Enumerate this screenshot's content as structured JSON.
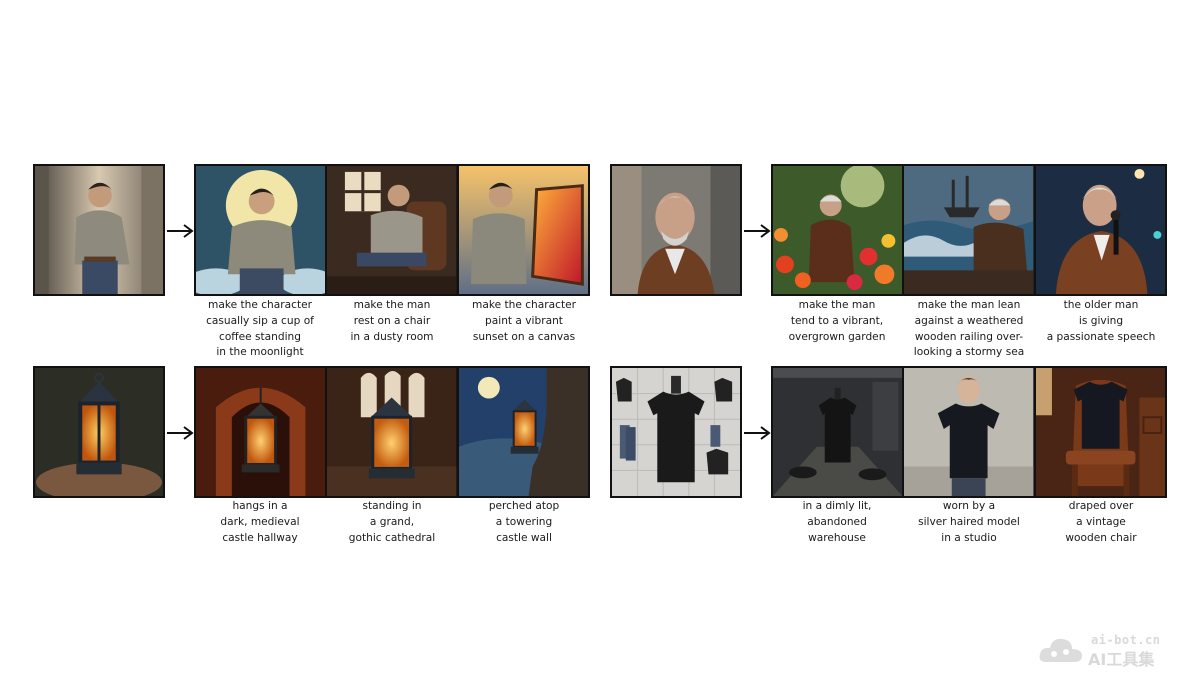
{
  "rows": [
    {
      "id": "character",
      "source_icon": "character-source-image",
      "outputs": [
        {
          "icon": "moonlight-coffee-image",
          "caption": "make the character\ncasually sip a cup of\ncoffee standing\nin the moonlight"
        },
        {
          "icon": "dusty-room-chair-image",
          "caption": "make the man\nrest on a chair\nin a dusty room"
        },
        {
          "icon": "sunset-canvas-painting-image",
          "caption": "make the character\npaint a vibrant\nsunset on a canvas"
        }
      ]
    },
    {
      "id": "older-man",
      "source_icon": "older-man-source-image",
      "outputs": [
        {
          "icon": "overgrown-garden-image",
          "caption": "make the man\ntend to a vibrant,\novergrown garden"
        },
        {
          "icon": "stormy-sea-railing-image",
          "caption": "make the man lean\nagainst a weathered\nwooden railing over-\nlooking a stormy sea"
        },
        {
          "icon": "passionate-speech-image",
          "caption": "the older man\nis giving\na passionate speech"
        }
      ]
    },
    {
      "id": "lantern",
      "source_icon": "lantern-source-image",
      "outputs": [
        {
          "icon": "castle-hallway-lantern-image",
          "caption": "hangs in a\ndark, medieval\ncastle hallway"
        },
        {
          "icon": "gothic-cathedral-lantern-image",
          "caption": "standing in\na grand,\ngothic cathedral"
        },
        {
          "icon": "castle-wall-lantern-image",
          "caption": "perched atop\na towering\ncastle wall"
        }
      ]
    },
    {
      "id": "tshirt",
      "source_icon": "tshirt-source-image",
      "outputs": [
        {
          "icon": "warehouse-tshirt-image",
          "caption": "in a dimly lit,\nabandoned\nwarehouse"
        },
        {
          "icon": "model-studio-tshirt-image",
          "caption": "worn by a\nsilver haired model\nin a studio"
        },
        {
          "icon": "vintage-chair-tshirt-image",
          "caption": "draped over\na vintage\nwooden chair"
        }
      ]
    }
  ],
  "watermark": {
    "url": "ai-bot.cn",
    "name": "AI工具集",
    "logo_icon": "cloud-logo-icon"
  },
  "arrow_icon": "right-arrow-icon"
}
